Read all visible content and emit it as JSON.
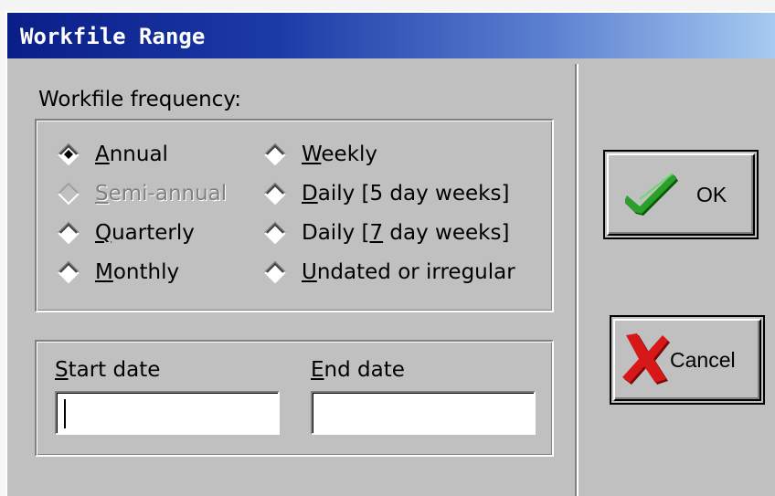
{
  "window": {
    "title": "Workfile Range"
  },
  "frequency": {
    "label": "Workfile frequency:",
    "options": [
      {
        "pre": "",
        "mn": "A",
        "post": "nnual",
        "selected": true,
        "enabled": true
      },
      {
        "pre": "",
        "mn": "S",
        "post": "emi-annual",
        "selected": false,
        "enabled": false
      },
      {
        "pre": "",
        "mn": "Q",
        "post": "uarterly",
        "selected": false,
        "enabled": true
      },
      {
        "pre": "",
        "mn": "M",
        "post": "onthly",
        "selected": false,
        "enabled": true
      },
      {
        "pre": "",
        "mn": "W",
        "post": "eekly",
        "selected": false,
        "enabled": true
      },
      {
        "pre": "",
        "mn": "D",
        "post": "aily [5 day weeks]",
        "selected": false,
        "enabled": true
      },
      {
        "pre": "Daily [",
        "mn": "7",
        "post": " day weeks]",
        "selected": false,
        "enabled": true
      },
      {
        "pre": "",
        "mn": "U",
        "post": "ndated or irregular",
        "selected": false,
        "enabled": true
      }
    ]
  },
  "dates": {
    "start": {
      "mn": "S",
      "rest": "tart date",
      "value": ""
    },
    "end": {
      "mn": "E",
      "rest": "nd date",
      "value": ""
    }
  },
  "buttons": {
    "ok": {
      "label": "OK",
      "icon": "checkmark-icon",
      "color": "#1a8a1a"
    },
    "cancel": {
      "label": "Cancel",
      "icon": "x-icon",
      "color": "#c81414"
    }
  }
}
